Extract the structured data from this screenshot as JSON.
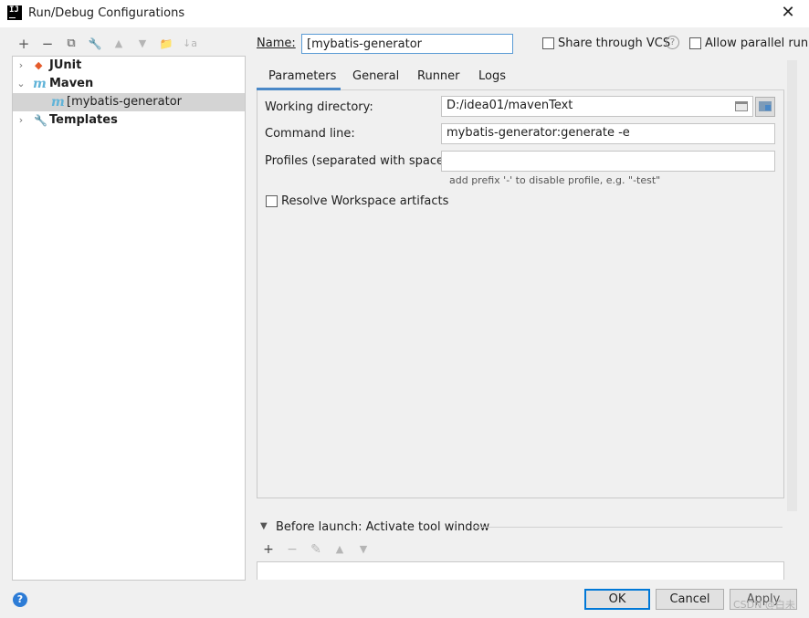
{
  "window": {
    "title": "Run/Debug Configurations",
    "icon": "intellij-icon",
    "close_label": "✕"
  },
  "toolbar": {
    "add": "+",
    "remove": "−",
    "copy": "⧉",
    "edit_defaults": "🔧",
    "move_up": "▲",
    "move_down": "▼",
    "new_folder": "📁",
    "sort": "↓a"
  },
  "tree": {
    "items": [
      {
        "label": "JUnit",
        "icon": "junit-icon",
        "expanded": false
      },
      {
        "label": "Maven",
        "icon": "maven-icon",
        "expanded": true
      },
      {
        "label": "[mybatis-generator",
        "icon": "maven-icon",
        "selected": true
      },
      {
        "label": "Templates",
        "icon": "wrench-icon",
        "expanded": false
      }
    ]
  },
  "name": {
    "label": "Name:",
    "value": "[mybatis-generator"
  },
  "share": {
    "label": "Share through VCS",
    "checked": false,
    "help": "?"
  },
  "parallel": {
    "label": "Allow parallel run",
    "checked": false
  },
  "tabs": [
    {
      "label": "Parameters",
      "active": true
    },
    {
      "label": "General"
    },
    {
      "label": "Runner"
    },
    {
      "label": "Logs"
    }
  ],
  "fields": {
    "working_dir": {
      "label": "Working directory:",
      "value": "D:/idea01/mavenText"
    },
    "command_line": {
      "label": "Command line:",
      "value": "mybatis-generator:generate -e"
    },
    "profiles": {
      "label": "Profiles (separated with space):",
      "value": "",
      "hint": "add prefix '-' to disable profile, e.g. \"-test\""
    },
    "resolve": {
      "label": "Resolve Workspace artifacts",
      "checked": false
    }
  },
  "before_launch": {
    "label": "Before launch: Activate tool window",
    "add": "+",
    "remove": "−",
    "edit": "✎",
    "up": "▲",
    "down": "▼"
  },
  "buttons": {
    "help": "?",
    "ok": "OK",
    "cancel": "Cancel",
    "apply": "Apply"
  },
  "watermark": "CSDN @白未"
}
